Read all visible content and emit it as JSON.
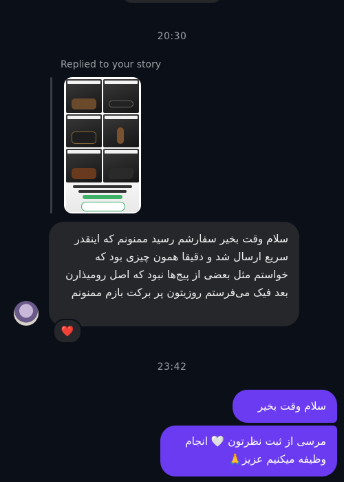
{
  "thread": {
    "timestamp_1": "20:30",
    "timestamp_2": "23:42"
  },
  "story_reply": {
    "label": "Replied to your story"
  },
  "incoming_message": {
    "text": "سلام وقت بخیر سفارشم رسید ممنونم که اینقدر سریع ارسال شد و دقیقا همون چیزی بود که خواستم مثل بعضی از پیج‌ها نبود که اصل رومیذارن بعد فیک می‌فرستم روزیتون پر برکت بازم ممنونم",
    "reaction": "❤️"
  },
  "outgoing_messages": [
    {
      "text": "سلام وقت بخیر"
    },
    {
      "text": "مرسی از ثبت نظرتون 🤍 انجام وظیفه میکنیم عزیز🙏"
    }
  ],
  "colors": {
    "background": "#0b0f17",
    "incoming_bubble": "#26272b",
    "outgoing_bubble": "#6a3bf0"
  }
}
